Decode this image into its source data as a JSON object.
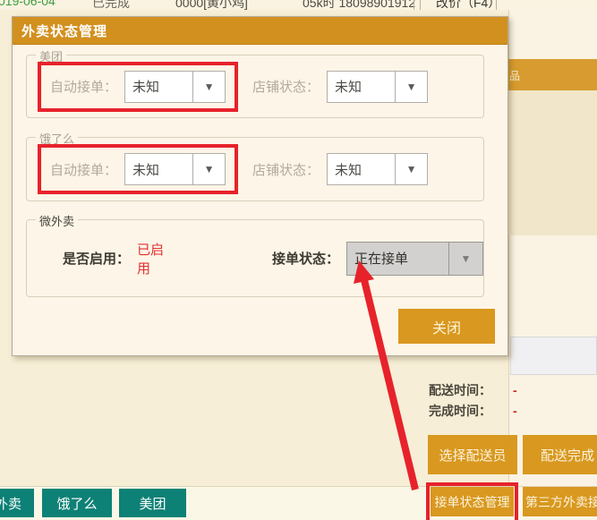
{
  "colors": {
    "header_orange": "#d2901e",
    "button_orange": "#d9981f",
    "tab_teal": "#0d8175",
    "annotation_red": "#e7222b",
    "enabled_red": "#e03030"
  },
  "top_row": {
    "date": "019-06-04",
    "status": "已完成",
    "item": "0000[黄小鸡]",
    "phone": "05k时 18098901912",
    "action": "改价（F4）"
  },
  "side_panel": {
    "partial_header": "品"
  },
  "modal": {
    "title": "外卖状态管理",
    "close_label": "关闭",
    "meituan": {
      "legend": "美团",
      "auto_label": "自动接单：",
      "auto_value": "未知",
      "shop_label": "店铺状态：",
      "shop_value": "未知"
    },
    "eleme": {
      "legend": "饿了么",
      "auto_label": "自动接单：",
      "auto_value": "未知",
      "shop_label": "店铺状态：",
      "shop_value": "未知"
    },
    "weiwaimai": {
      "legend": "微外卖",
      "enabled_label": "是否启用：",
      "enabled_value": "已启用",
      "status_label": "接单状态：",
      "status_value": "正在接单"
    }
  },
  "delivery": {
    "rows": [
      {
        "label": "配送时间：",
        "value": "-"
      },
      {
        "label": "完成时间：",
        "value": "-"
      }
    ],
    "select_courier_label": "选择配送员",
    "done_label": "配送完成"
  },
  "bottom_bar": {
    "tabs": [
      "外卖",
      "饿了么",
      "美团"
    ],
    "status_manage_label": "接单状态管理",
    "third_party_label": "第三方外卖接单"
  }
}
